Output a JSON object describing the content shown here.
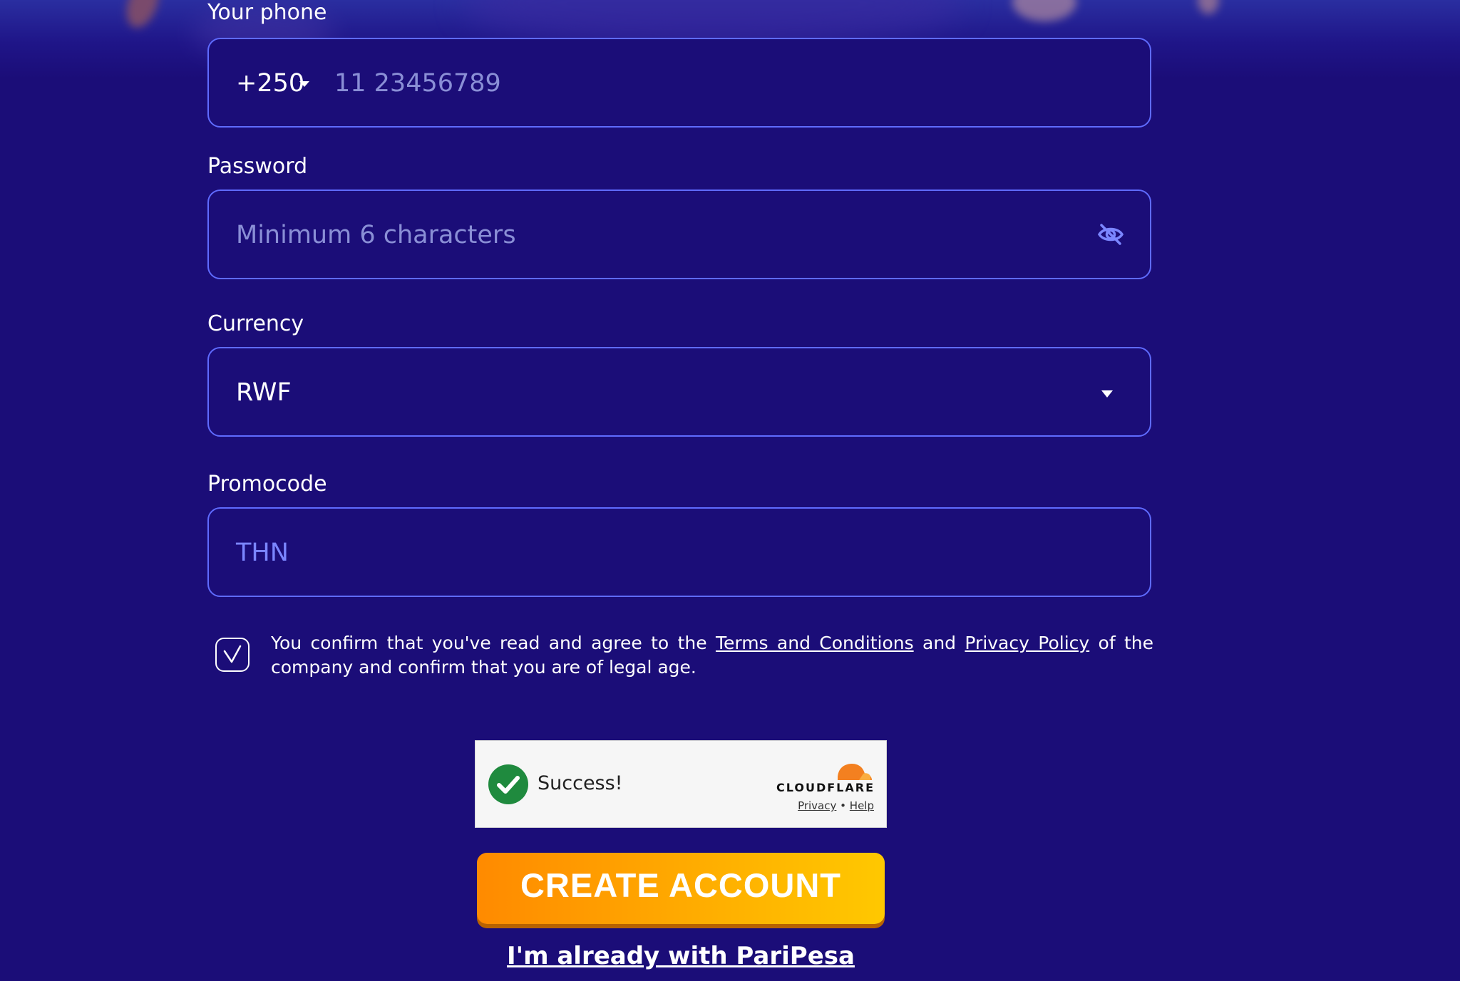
{
  "form": {
    "phone": {
      "label": "Your phone",
      "code": "+250",
      "placeholder": "11 23456789"
    },
    "password": {
      "label": "Password",
      "placeholder": "Minimum 6 characters",
      "toggle_icon": "eye-slash-icon"
    },
    "currency": {
      "label": "Currency",
      "value": "RWF"
    },
    "promocode": {
      "label": "Promocode",
      "value": "THN"
    },
    "terms": {
      "text_before": "You confirm that you've read and agree to the",
      "terms_link": "Terms and Conditions",
      "and": "and",
      "privacy_link": "Privacy Policy",
      "text_after": "of the company and confirm that you are of legal age.",
      "checked": true
    }
  },
  "captcha": {
    "status": "Success!",
    "brand": "CLOUDFLARE",
    "privacy": "Privacy",
    "separator": "•",
    "help": "Help"
  },
  "actions": {
    "create_account": "CREATE ACCOUNT",
    "login_link": "I'm already with PariPesa"
  },
  "colors": {
    "background": "#1b0d78",
    "field_border": "#5f6bff",
    "promo_text": "#7b86ff",
    "cta_gradient_start": "#ff8a00",
    "cta_gradient_end": "#ffc800",
    "success_green": "#1f8a3e"
  }
}
